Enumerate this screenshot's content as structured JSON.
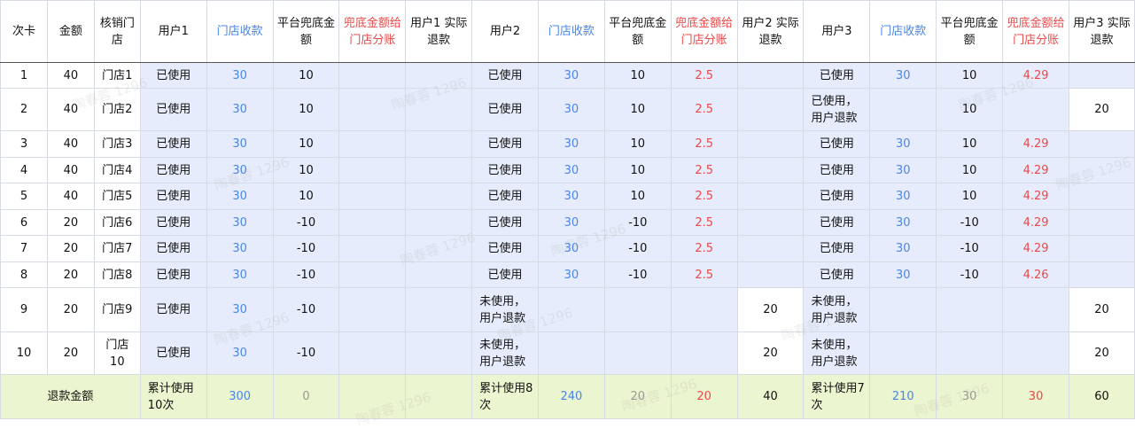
{
  "header": [
    "次卡",
    "金额",
    "核销门店",
    "用户1",
    "门店收款",
    "平台兜底金额",
    "兜底金额给门店分账",
    "用户1 实际退款",
    "用户2",
    "门店收款",
    "平台兜底金额",
    "兜底金额给门店分账",
    "用户2 实际退款",
    "用户3",
    "门店收款",
    "平台兜底金额",
    "兜底金额给门店分账",
    "用户3 实际退款"
  ],
  "rows": [
    [
      "1",
      "40",
      "门店1",
      "已使用",
      "30",
      "10",
      "",
      "",
      "已使用",
      "30",
      "10",
      "2.5",
      "",
      "已使用",
      "30",
      "10",
      "4.29",
      ""
    ],
    [
      "2",
      "40",
      "门店2",
      "已使用",
      "30",
      "10",
      "",
      "",
      "已使用",
      "30",
      "10",
      "2.5",
      "",
      "已使用，用户退款",
      "",
      "10",
      "",
      "20"
    ],
    [
      "3",
      "40",
      "门店3",
      "已使用",
      "30",
      "10",
      "",
      "",
      "已使用",
      "30",
      "10",
      "2.5",
      "",
      "已使用",
      "30",
      "10",
      "4.29",
      ""
    ],
    [
      "4",
      "40",
      "门店4",
      "已使用",
      "30",
      "10",
      "",
      "",
      "已使用",
      "30",
      "10",
      "2.5",
      "",
      "已使用",
      "30",
      "10",
      "4.29",
      ""
    ],
    [
      "5",
      "40",
      "门店5",
      "已使用",
      "30",
      "10",
      "",
      "",
      "已使用",
      "30",
      "10",
      "2.5",
      "",
      "已使用",
      "30",
      "10",
      "4.29",
      ""
    ],
    [
      "6",
      "20",
      "门店6",
      "已使用",
      "30",
      "-10",
      "",
      "",
      "已使用",
      "30",
      "-10",
      "2.5",
      "",
      "已使用",
      "30",
      "-10",
      "4.29",
      ""
    ],
    [
      "7",
      "20",
      "门店7",
      "已使用",
      "30",
      "-10",
      "",
      "",
      "已使用",
      "30",
      "-10",
      "2.5",
      "",
      "已使用",
      "30",
      "-10",
      "4.29",
      ""
    ],
    [
      "8",
      "20",
      "门店8",
      "已使用",
      "30",
      "-10",
      "",
      "",
      "已使用",
      "30",
      "-10",
      "2.5",
      "",
      "已使用",
      "30",
      "-10",
      "4.26",
      ""
    ],
    [
      "9",
      "20",
      "门店9",
      "已使用",
      "30",
      "-10",
      "",
      "",
      "未使用，用户退款",
      "",
      "",
      "",
      "20",
      "未使用，用户退款",
      "",
      "",
      "",
      "20"
    ],
    [
      "10",
      "20",
      "门店10",
      "已使用",
      "30",
      "-10",
      "",
      "",
      "未使用，用户退款",
      "",
      "",
      "",
      "20",
      "未使用，用户退款",
      "",
      "",
      "",
      "20"
    ]
  ],
  "total": {
    "label": "退款金额",
    "u1_used": "累计使用10次",
    "u1_store": "300",
    "u1_platform": "0",
    "u2_used": "累计使用8次",
    "u2_store": "240",
    "u2_platform": "20",
    "u2_split": "20",
    "u2_refund": "40",
    "u3_used": "累计使用7次",
    "u3_store": "210",
    "u3_platform": "30",
    "u3_split": "30",
    "u3_refund": "60"
  },
  "watermark": "陶春蓉 1296",
  "colors": {
    "blue_text": "#4a86e8",
    "red_text": "#e84a4a",
    "row_bg": "#e6ecfb",
    "total_bg": "#ebf5cf"
  }
}
